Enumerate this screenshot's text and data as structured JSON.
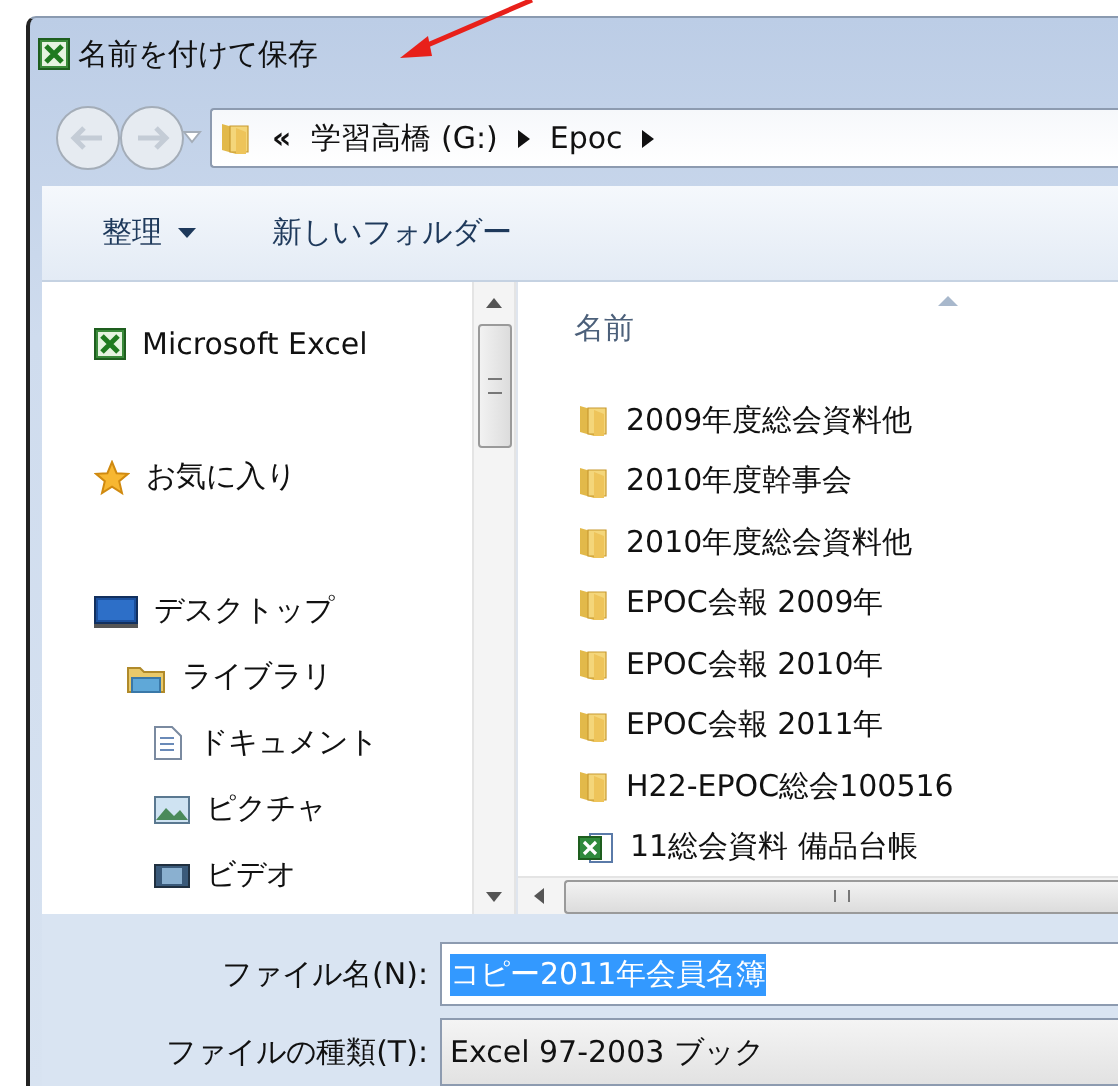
{
  "window": {
    "title": "名前を付けて保存"
  },
  "address": {
    "overflow": "«",
    "path": [
      "学習高橋 (G:)",
      "Epoc"
    ]
  },
  "toolbar": [
    {
      "label": "整理",
      "dropdown": true
    },
    {
      "label": "新しいフォルダー",
      "dropdown": false
    }
  ],
  "sidebar": {
    "items": [
      {
        "label": "Microsoft Excel",
        "kind": "excel"
      },
      {
        "label": "お気に入り",
        "kind": "star"
      },
      {
        "label": "デスクトップ",
        "kind": "desktop"
      },
      {
        "label": "ライブラリ",
        "kind": "library",
        "children": [
          {
            "label": "ドキュメント",
            "kind": "document"
          },
          {
            "label": "ピクチャ",
            "kind": "picture"
          },
          {
            "label": "ビデオ",
            "kind": "video"
          }
        ]
      }
    ]
  },
  "file_list": {
    "columns": [
      "名前"
    ],
    "rows": [
      {
        "name": "2009年度総会資料他",
        "kind": "folder"
      },
      {
        "name": "2010年度幹事会",
        "kind": "folder"
      },
      {
        "name": "2010年度総会資料他",
        "kind": "folder"
      },
      {
        "name": "EPOC会報 2009年",
        "kind": "folder"
      },
      {
        "name": "EPOC会報 2010年",
        "kind": "folder"
      },
      {
        "name": "EPOC会報 2011年",
        "kind": "folder"
      },
      {
        "name": "H22-EPOC総会100516",
        "kind": "folder"
      },
      {
        "name": "11総会資料 備品台帳",
        "kind": "excel"
      }
    ]
  },
  "file_name": {
    "label": "ファイル名(N):",
    "value": "コピー2011年会員名簿",
    "selected": true
  },
  "file_type": {
    "label": "ファイルの種類(T):",
    "value": "Excel 97-2003 ブック"
  }
}
